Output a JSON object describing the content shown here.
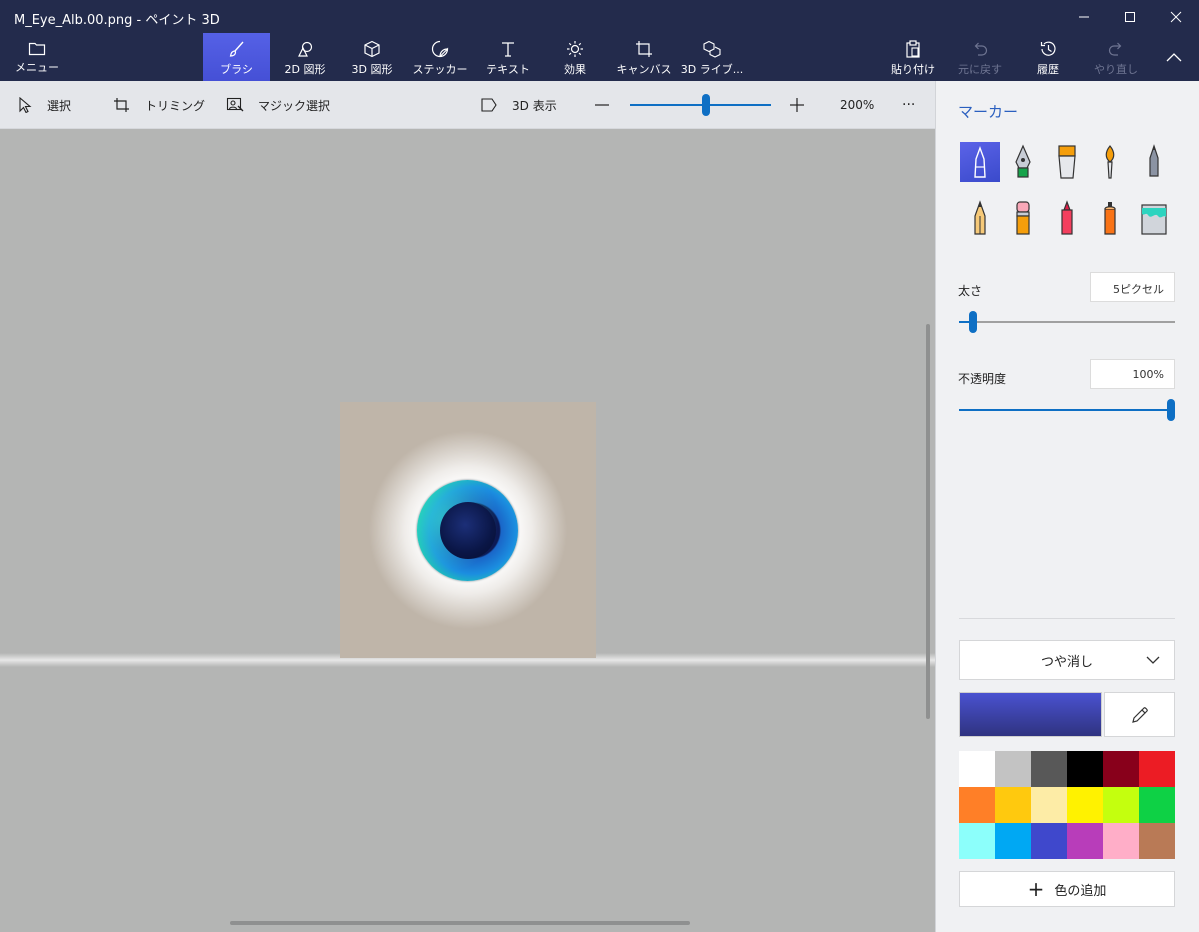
{
  "window": {
    "title": "M_Eye_Alb.00.png - ペイント 3D"
  },
  "ribbon": {
    "menu_label": "メニュー",
    "tools": [
      {
        "label": "ブラシ",
        "icon": "brush-icon",
        "active": true
      },
      {
        "label": "2D 図形",
        "icon": "2d-shapes-icon"
      },
      {
        "label": "3D 図形",
        "icon": "3d-shapes-icon"
      },
      {
        "label": "ステッカー",
        "icon": "sticker-icon"
      },
      {
        "label": "テキスト",
        "icon": "text-icon"
      },
      {
        "label": "効果",
        "icon": "effects-icon"
      },
      {
        "label": "キャンバス",
        "icon": "canvas-icon"
      },
      {
        "label": "3D ライブ...",
        "icon": "3d-library-icon"
      }
    ],
    "right": [
      {
        "label": "貼り付け",
        "icon": "paste-icon",
        "enabled": true
      },
      {
        "label": "元に戻す",
        "icon": "undo-icon",
        "enabled": false
      },
      {
        "label": "履歴",
        "icon": "history-icon",
        "enabled": true
      },
      {
        "label": "やり直し",
        "icon": "redo-icon",
        "enabled": false
      }
    ]
  },
  "toolbar": {
    "select_label": "選択",
    "trim_label": "トリミング",
    "magic_select_label": "マジック選択",
    "view3d_label": "3D 表示",
    "zoom_level": "200%",
    "zoom_slider_fraction": 0.54,
    "more_label": "···"
  },
  "panel": {
    "title": "マーカー",
    "brushes": [
      {
        "icon": "marker-icon",
        "selected": true
      },
      {
        "icon": "calligraphy-pen-icon"
      },
      {
        "icon": "oil-brush-icon"
      },
      {
        "icon": "watercolor-icon"
      },
      {
        "icon": "pixel-pen-icon"
      },
      {
        "icon": "pencil-icon"
      },
      {
        "icon": "eraser-icon"
      },
      {
        "icon": "crayon-icon"
      },
      {
        "icon": "spray-can-icon"
      },
      {
        "icon": "fill-icon"
      }
    ],
    "thickness_label": "太さ",
    "thickness_value": "5ピクセル",
    "thickness_fraction": 0.03,
    "opacity_label": "不透明度",
    "opacity_value": "100%",
    "opacity_fraction": 1.0,
    "finish": "つや消し",
    "current_color": "#4a52d0",
    "palette": [
      "#ffffff",
      "#c3c3c3",
      "#585858",
      "#000000",
      "#88001b",
      "#ec1c24",
      "#ff7f27",
      "#ffc90e",
      "#fdeca6",
      "#fff200",
      "#c4ff0e",
      "#0ed145",
      "#8cfffb",
      "#00a8f3",
      "#3f48cc",
      "#b83dba",
      "#ffaec8",
      "#b97a56"
    ],
    "add_color_label": "色の追加"
  }
}
